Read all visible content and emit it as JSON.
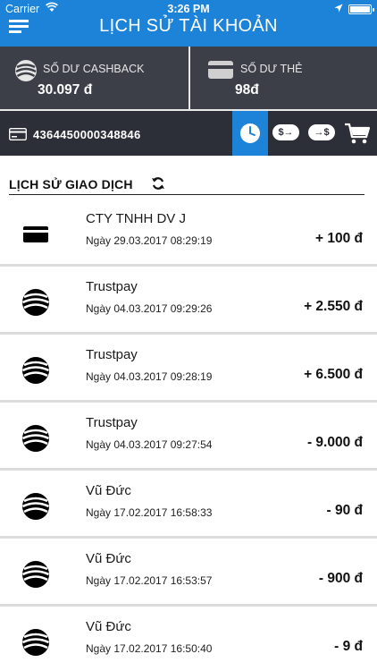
{
  "status_bar": {
    "carrier": "Carrier",
    "time": "3:26 PM"
  },
  "header": {
    "title": "LỊCH SỬ TÀI KHOẢN",
    "menu_icon": "hamburger-menu-icon"
  },
  "balances": {
    "cashback": {
      "label": "SỐ DƯ CASHBACK",
      "value": "30.097 đ",
      "icon": "trustpay-logo-icon"
    },
    "card": {
      "label": "SỐ DƯ THẺ",
      "value": "98đ",
      "icon": "card-icon"
    }
  },
  "account": {
    "number": "4364450000348846",
    "icon": "card-outline-icon",
    "tools": [
      {
        "name": "history",
        "icon": "clock-icon",
        "active": true
      },
      {
        "name": "deposit",
        "icon": "dollar-in-icon",
        "label": "$→"
      },
      {
        "name": "withdraw",
        "icon": "dollar-out-icon",
        "label": "→$"
      },
      {
        "name": "cart",
        "icon": "cart-icon"
      }
    ]
  },
  "history": {
    "title": "LỊCH SỬ GIAO DỊCH",
    "refresh_icon": "refresh-icon",
    "transactions": [
      {
        "icon": "card-icon",
        "name": "CTY TNHH DV J",
        "date": "Ngày 29.03.2017 08:29:19",
        "amount": "+ 100 đ"
      },
      {
        "icon": "trustpay-logo-icon",
        "name": "Trustpay",
        "date": "Ngày 04.03.2017 09:29:26",
        "amount": "+ 2.550 đ"
      },
      {
        "icon": "trustpay-logo-icon",
        "name": "Trustpay",
        "date": "Ngày 04.03.2017 09:28:19",
        "amount": "+ 6.500 đ"
      },
      {
        "icon": "trustpay-logo-icon",
        "name": "Trustpay",
        "date": "Ngày 04.03.2017 09:27:54",
        "amount": "- 9.000 đ"
      },
      {
        "icon": "trustpay-logo-icon",
        "name": "Vũ Đức",
        "date": "Ngày 17.02.2017 16:58:33",
        "amount": "- 90 đ"
      },
      {
        "icon": "trustpay-logo-icon",
        "name": "Vũ Đức",
        "date": "Ngày 17.02.2017 16:53:57",
        "amount": "- 900 đ"
      },
      {
        "icon": "trustpay-logo-icon",
        "name": "Vũ Đức",
        "date": "Ngày 17.02.2017 16:50:40",
        "amount": "- 9 đ"
      }
    ]
  },
  "colors": {
    "primary": "#1c83d8",
    "panel_dark": "#3c3f48",
    "bar_dark": "#2c2f37"
  }
}
